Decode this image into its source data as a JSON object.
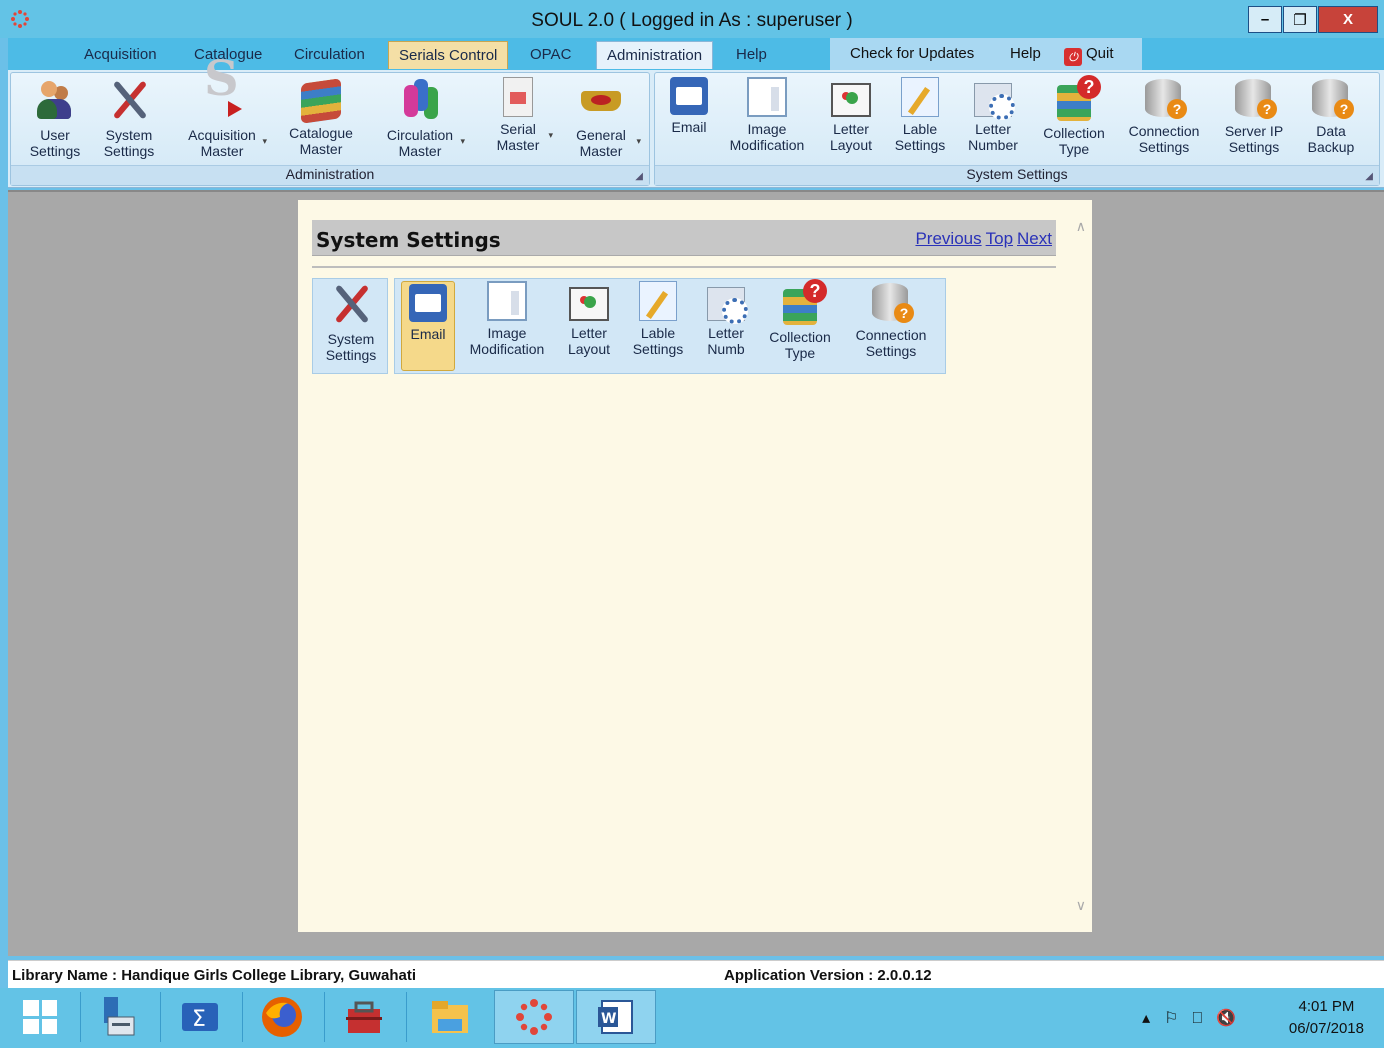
{
  "window": {
    "title": "SOUL 2.0  ( Logged in As : superuser )",
    "minimize": "–",
    "restore": "❐",
    "close": "X"
  },
  "menu": {
    "tabs": [
      "Acquisition",
      "Catalogue",
      "Circulation",
      "Serials Control",
      "OPAC",
      "Administration",
      "Help"
    ],
    "check_updates": "Check for Updates",
    "help": "Help",
    "quit": "Quit"
  },
  "ribbon": {
    "administration_group": {
      "label": "Administration",
      "buttons": [
        {
          "line1": "User",
          "line2": "Settings",
          "icon": "user-settings-icon"
        },
        {
          "line1": "System",
          "line2": "Settings",
          "icon": "tools-icon"
        },
        {
          "line1": "Acquisition",
          "line2": "Master",
          "icon": "acquisition-icon"
        },
        {
          "line1": "Catalogue",
          "line2": "Master",
          "icon": "books-icon"
        },
        {
          "line1": "Circulation",
          "line2": "Master",
          "icon": "circulation-icon"
        },
        {
          "line1": "Serial",
          "line2": "Master",
          "icon": "serial-icon"
        },
        {
          "line1": "General",
          "line2": "Master",
          "icon": "crown-icon"
        }
      ]
    },
    "system_group": {
      "label": "System Settings",
      "buttons": [
        {
          "line1": "Email",
          "line2": "",
          "icon": "email-icon"
        },
        {
          "line1": "Image",
          "line2": "Modification",
          "icon": "image-modification-icon"
        },
        {
          "line1": "Letter",
          "line2": "Layout",
          "icon": "letter-layout-icon"
        },
        {
          "line1": "Lable",
          "line2": "Settings",
          "icon": "label-settings-icon"
        },
        {
          "line1": "Letter",
          "line2": "Number",
          "icon": "letter-number-icon"
        },
        {
          "line1": "Collection",
          "line2": "Type",
          "icon": "collection-type-icon"
        },
        {
          "line1": "Connection",
          "line2": "Settings",
          "icon": "database-icon"
        },
        {
          "line1": "Server IP",
          "line2": "Settings",
          "icon": "database-icon"
        },
        {
          "line1": "Data",
          "line2": "Backup",
          "icon": "database-icon"
        }
      ]
    }
  },
  "panel": {
    "title": "System Settings",
    "nav_previous": "Previous",
    "nav_top": "Top",
    "nav_next": "Next",
    "mini_first": {
      "line1": "System",
      "line2": "Settings"
    },
    "mini_buttons": [
      {
        "line1": "Email",
        "line2": ""
      },
      {
        "line1": "Image",
        "line2": "Modification"
      },
      {
        "line1": "Letter",
        "line2": "Layout"
      },
      {
        "line1": "Lable",
        "line2": "Settings"
      },
      {
        "line1": "Letter",
        "line2": "Numb"
      },
      {
        "line1": "Collection",
        "line2": "Type"
      },
      {
        "line1": "Connection",
        "line2": "Settings"
      }
    ]
  },
  "status": {
    "library": "Library Name : Handique Girls College Library, Guwahati",
    "version": "Application Version : 2.0.0.12"
  },
  "taskbar": {
    "time": "4:01 PM",
    "date": "06/07/2018"
  },
  "colors": {
    "titlebar": "#63c3e6",
    "menubar": "#4dbbe6",
    "panel_bg": "#fdf9e6",
    "link": "#2a32b8",
    "selected": "#f5d98a"
  }
}
